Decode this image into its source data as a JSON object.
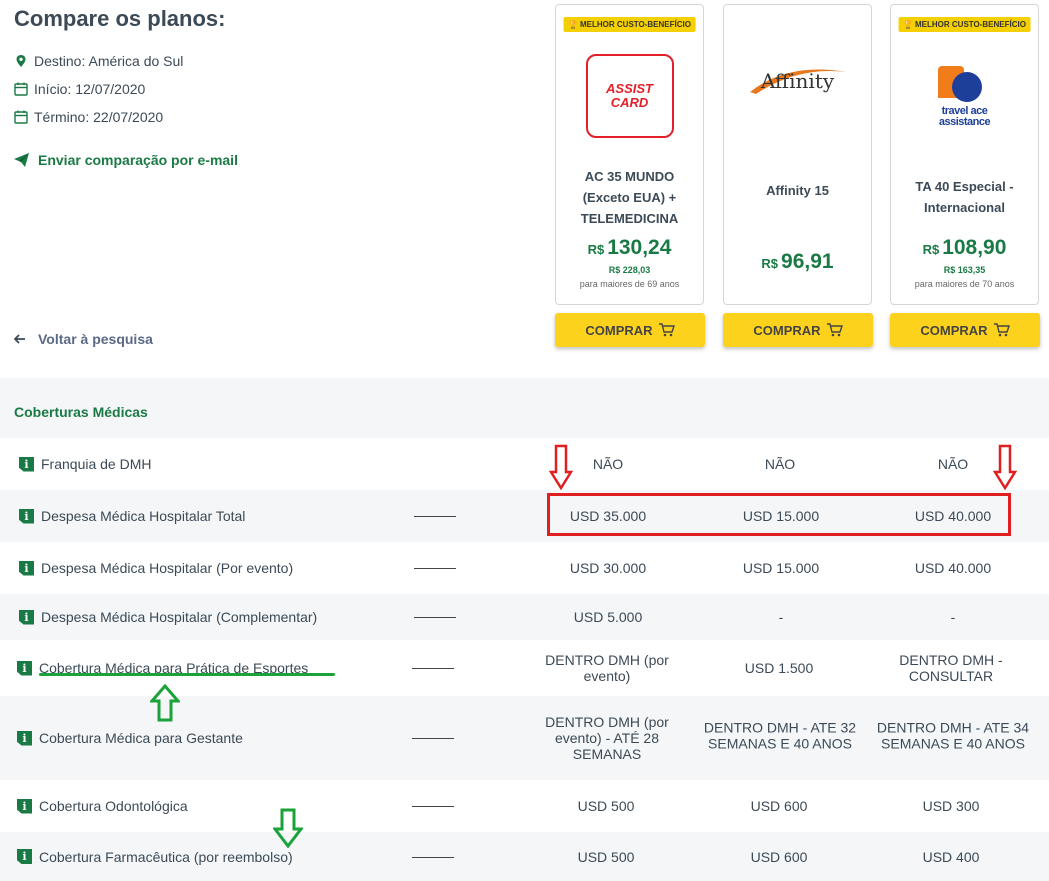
{
  "page": {
    "title": "Compare os planos:",
    "destination": "Destino: América do Sul",
    "start": "Início: 12/07/2020",
    "end": "Término: 22/07/2020",
    "email_link": "Enviar comparação por e-mail",
    "back_link": "Voltar à pesquisa"
  },
  "plans": [
    {
      "badge": "MELHOR CUSTO-BENEFÍCIO",
      "logo_text": "ASSIST CARD",
      "name": "AC 35 MUNDO (Exceto EUA) + TELEMEDICINA",
      "currency": "R$",
      "price": "130,24",
      "old_price": "R$ 228,03",
      "note": "para maiores de 69 anos",
      "buy": "COMPRAR"
    },
    {
      "badge": "",
      "logo_text": "Affinity",
      "name": "Affinity 15",
      "currency": "R$",
      "price": "96,91",
      "old_price": "",
      "note": "",
      "buy": "COMPRAR"
    },
    {
      "badge": "MELHOR CUSTO-BENEFÍCIO",
      "logo_text": "travel ace assistance",
      "name": "TA 40 Especial - Internacional",
      "currency": "R$",
      "price": "108,90",
      "old_price": "R$ 163,35",
      "note": "para maiores de 70 anos",
      "buy": "COMPRAR"
    }
  ],
  "section": {
    "title": "Coberturas Médicas"
  },
  "rows": [
    {
      "label": "Franquia de DMH",
      "values": [
        "NÃO",
        "NÃO",
        "NÃO"
      ]
    },
    {
      "label": "Despesa Médica Hospitalar Total",
      "values": [
        "USD 35.000",
        "USD 15.000",
        "USD 40.000"
      ]
    },
    {
      "label": "Despesa Médica Hospitalar (Por evento)",
      "values": [
        "USD 30.000",
        "USD 15.000",
        "USD 40.000"
      ]
    },
    {
      "label": "Despesa Médica Hospitalar (Complementar)",
      "values": [
        "USD 5.000",
        "-",
        "-"
      ]
    },
    {
      "label": "Cobertura Médica para Prática de Esportes",
      "values": [
        "DENTRO DMH (por evento)",
        "USD 1.500",
        "DENTRO DMH - CONSULTAR"
      ]
    },
    {
      "label": "Cobertura Médica para Gestante",
      "values": [
        "DENTRO DMH (por evento) - ATÉ 28 SEMANAS",
        "DENTRO DMH - ATE 32 SEMANAS E 40 ANOS",
        "DENTRO DMH - ATE 34 SEMANAS E 40 ANOS"
      ]
    },
    {
      "label": "Cobertura Odontológica",
      "values": [
        "USD 500",
        "USD 600",
        "USD 300"
      ]
    },
    {
      "label": "Cobertura Farmacêutica (por reembolso)",
      "values": [
        "USD 500",
        "USD 600",
        "USD 400"
      ]
    }
  ],
  "colors": {
    "brand_green": "#1a7a45",
    "button_yellow": "#fcd21d",
    "badge_yellow": "#f5d000",
    "annotation_red": "#e02020",
    "annotation_green": "#1aa33a",
    "row_alt_bg": "#f4f6f7"
  },
  "icons": [
    "map-pin-icon",
    "calendar-icon",
    "send-icon",
    "arrow-left-icon",
    "trophy-icon",
    "cart-icon",
    "info-icon"
  ]
}
